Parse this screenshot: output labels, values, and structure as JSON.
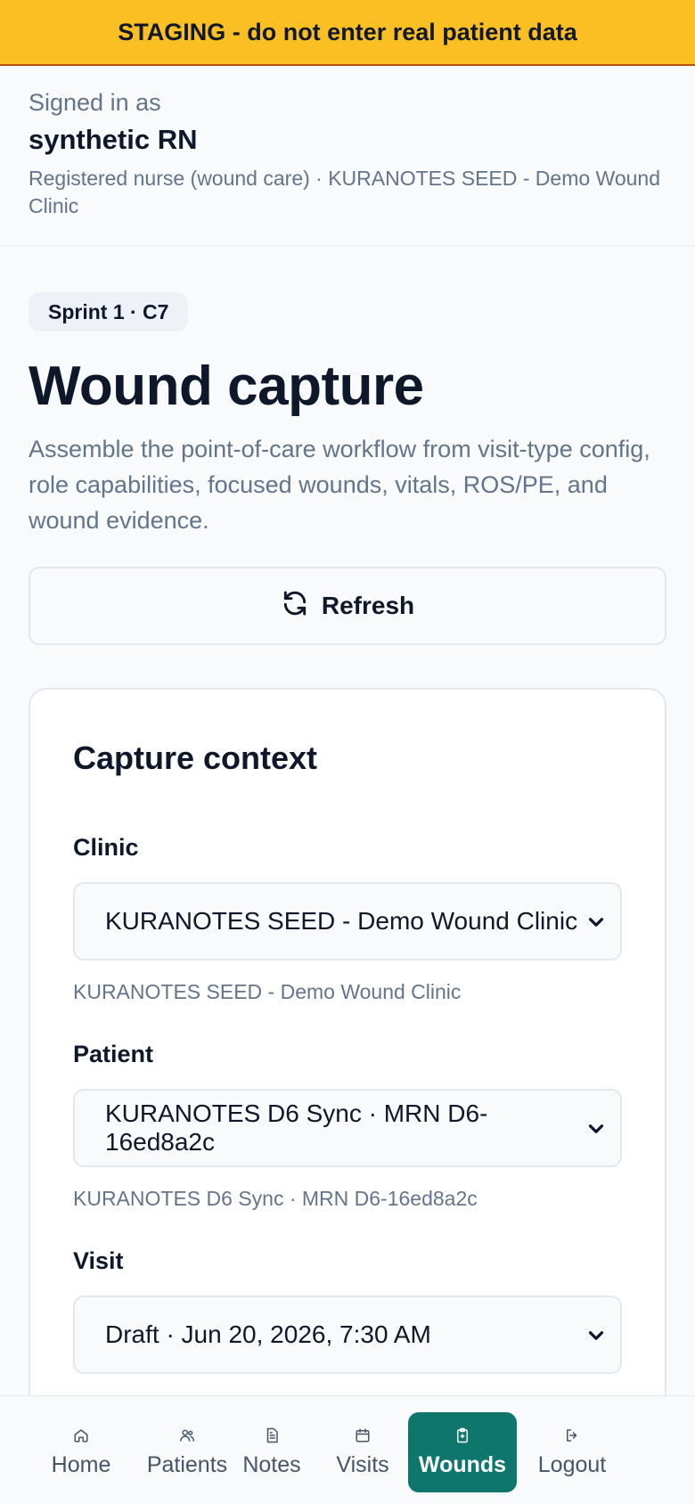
{
  "banner": {
    "text": "STAGING - do not enter real patient data"
  },
  "session": {
    "label": "Signed in as",
    "user": "synthetic RN",
    "role_line": "Registered nurse (wound care) · KURANOTES SEED - Demo Wound Clinic"
  },
  "page": {
    "badge": "Sprint 1 · C7",
    "title": "Wound capture",
    "description": "Assemble the point-of-care workflow from visit-type config, role capabilities, focused wounds, vitals, ROS/PE, and wound evidence.",
    "refresh_label": "Refresh"
  },
  "capture": {
    "title": "Capture context",
    "clinic": {
      "label": "Clinic",
      "value": "KURANOTES SEED - Demo Wound Clinic",
      "hint": "KURANOTES SEED - Demo Wound Clinic"
    },
    "patient": {
      "label": "Patient",
      "value": "KURANOTES D6 Sync · MRN D6-16ed8a2c",
      "hint": "KURANOTES D6 Sync · MRN D6-16ed8a2c"
    },
    "visit": {
      "label": "Visit",
      "value": "Draft · Jun 20, 2026, 7:30 AM"
    }
  },
  "nav": {
    "items": [
      {
        "label": "Home",
        "icon": "home-icon"
      },
      {
        "label": "Patients",
        "icon": "users-icon"
      },
      {
        "label": "Notes",
        "icon": "document-icon"
      },
      {
        "label": "Visits",
        "icon": "calendar-icon"
      },
      {
        "label": "Wounds",
        "icon": "clipboard-icon",
        "active": true
      },
      {
        "label": "Logout",
        "icon": "logout-icon"
      }
    ]
  },
  "colors": {
    "banner": "#fbbf24",
    "accent": "#0f766e",
    "muted_text": "#64748b"
  }
}
